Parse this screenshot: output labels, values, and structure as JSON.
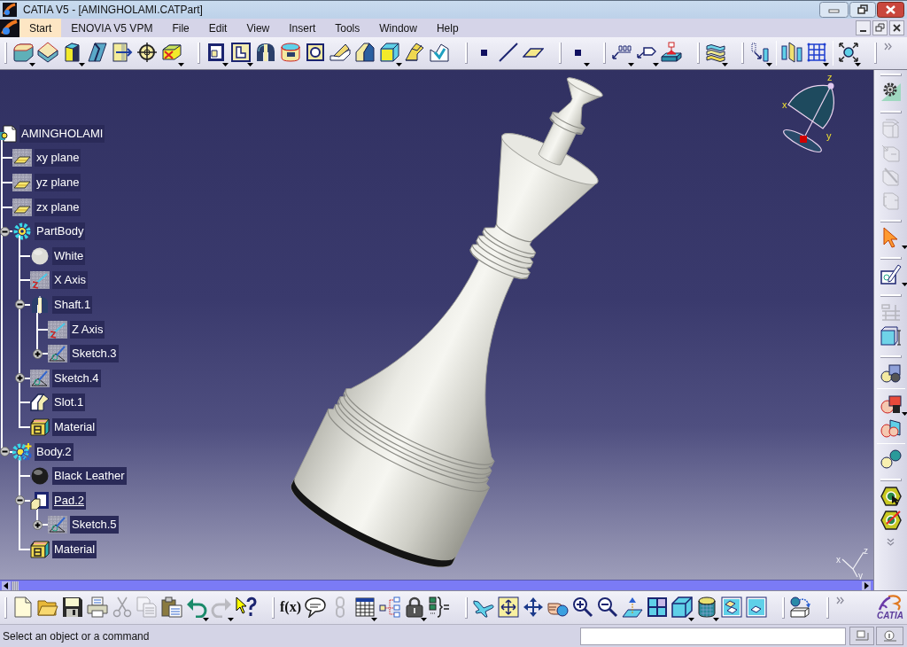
{
  "window": {
    "title": "CATIA V5 - [AMINGHOLAMI.CATPart]"
  },
  "menu": [
    {
      "label": "Start",
      "selected": true
    },
    {
      "label": "ENOVIA V5 VPM",
      "selected": false
    },
    {
      "label": "File",
      "selected": false
    },
    {
      "label": "Edit",
      "selected": false
    },
    {
      "label": "View",
      "selected": false
    },
    {
      "label": "Insert",
      "selected": false
    },
    {
      "label": "Tools",
      "selected": false
    },
    {
      "label": "Window",
      "selected": false
    },
    {
      "label": "Help",
      "selected": false
    }
  ],
  "top_toolbar": {
    "groups": [
      {
        "sections": [
          [
            {
              "kind": "pad",
              "menu": true
            },
            {
              "kind": "pocket",
              "menu": false
            },
            {
              "kind": "shaft",
              "menu": true
            },
            {
              "kind": "rib",
              "menu": false
            },
            {
              "kind": "hole",
              "menu": false
            },
            {
              "kind": "target",
              "menu": false
            },
            {
              "kind": "remove",
              "menu": true
            }
          ]
        ]
      },
      {
        "sections": [
          [
            {
              "kind": "frame",
              "menu": true
            },
            {
              "kind": "lframe",
              "menu": true
            },
            {
              "kind": "splitcyl",
              "menu": false
            },
            {
              "kind": "cylinder",
              "menu": false
            },
            {
              "kind": "ring",
              "menu": false
            },
            {
              "kind": "wedge",
              "menu": false
            },
            {
              "kind": "step",
              "menu": false
            },
            {
              "kind": "cube",
              "menu": true
            },
            {
              "kind": "sheet",
              "menu": false
            },
            {
              "kind": "splitsheet",
              "menu": false
            }
          ]
        ]
      },
      {
        "sections": [
          [
            {
              "kind": "point",
              "menu": false
            },
            {
              "kind": "line",
              "menu": false
            },
            {
              "kind": "plane",
              "menu": false
            }
          ]
        ]
      },
      {
        "sections": [
          [
            {
              "kind": "point",
              "menu": true
            }
          ]
        ]
      },
      {
        "sections": [
          [
            {
              "kind": "textarrow",
              "menu": true
            },
            {
              "kind": "tagarrow",
              "menu": true
            },
            {
              "kind": "stamp",
              "menu": false
            }
          ]
        ]
      },
      {
        "sections": [
          [
            {
              "kind": "layers",
              "menu": true
            }
          ]
        ]
      },
      {
        "sections": [
          [
            {
              "kind": "colarrow",
              "menu": true
            }
          ],
          [
            {
              "kind": "mirror",
              "menu": false
            },
            {
              "kind": "grid",
              "menu": true
            }
          ],
          [
            {
              "kind": "fit",
              "menu": true
            }
          ]
        ]
      }
    ],
    "overflow": true
  },
  "tree": {
    "label": "AMINGHOLAMI",
    "kind": "part",
    "in_work": false,
    "children": [
      {
        "label": "xy plane",
        "kind": "plane",
        "in_work": false
      },
      {
        "label": "yz plane",
        "kind": "plane",
        "in_work": false
      },
      {
        "label": "zx plane",
        "kind": "plane",
        "in_work": false
      },
      {
        "label": "PartBody",
        "kind": "body",
        "in_work": false,
        "expanded": true,
        "children": [
          {
            "label": "White",
            "kind": "appearance",
            "color": "#dcdcd6",
            "in_work": false
          },
          {
            "label": "X Axis",
            "kind": "axis",
            "in_work": false
          },
          {
            "label": "Shaft.1",
            "kind": "shaft",
            "in_work": false,
            "expanded": true,
            "children": [
              {
                "label": "Z Axis",
                "kind": "axis",
                "in_work": false
              },
              {
                "label": "Sketch.3",
                "kind": "sketch",
                "in_work": false,
                "expanded": false
              }
            ]
          },
          {
            "label": "Sketch.4",
            "kind": "sketch",
            "in_work": false,
            "expanded": false
          },
          {
            "label": "Slot.1",
            "kind": "slot",
            "in_work": false
          },
          {
            "label": "Material",
            "kind": "material",
            "in_work": false
          }
        ]
      },
      {
        "label": "Body.2",
        "kind": "newbody",
        "in_work": false,
        "expanded": true,
        "children": [
          {
            "label": "Black Leather",
            "kind": "appearance",
            "color": "#1c1c1c",
            "in_work": false
          },
          {
            "label": "Pad.2",
            "kind": "pad",
            "in_work": true,
            "expanded": true,
            "children": [
              {
                "label": "Sketch.5",
                "kind": "sketch",
                "in_work": false,
                "expanded": false
              }
            ]
          },
          {
            "label": "Material",
            "kind": "material",
            "in_work": false
          }
        ]
      }
    ]
  },
  "compass": {
    "labels": [
      "z",
      "x",
      "y"
    ]
  },
  "axis_triad": {
    "labels": [
      "z",
      "x",
      "y"
    ]
  },
  "right_toolbar": {
    "groups": [
      {
        "sections": [
          [
            {
              "kind": "gear",
              "menu": false,
              "disabled": false
            }
          ]
        ]
      },
      {
        "sections": [
          [
            {
              "kind": "stackblock",
              "menu": false,
              "disabled": true
            },
            {
              "kind": "arrowblock",
              "menu": false,
              "disabled": true
            },
            {
              "kind": "cutblock",
              "menu": false,
              "disabled": true
            },
            {
              "kind": "bracketblock",
              "menu": false,
              "disabled": true
            }
          ]
        ]
      },
      {
        "sections": [
          [
            {
              "kind": "cursor",
              "menu": true,
              "disabled": false
            }
          ]
        ]
      },
      {
        "sections": [
          [
            {
              "kind": "pencilsheet",
              "menu": true,
              "disabled": false
            }
          ]
        ]
      },
      {
        "sections": [
          [
            {
              "kind": "shelf",
              "menu": false,
              "disabled": true
            },
            {
              "kind": "dimension",
              "menu": false,
              "disabled": false
            }
          ]
        ]
      },
      {
        "sections": [
          [
            {
              "kind": "assembly",
              "menu": false,
              "disabled": false
            }
          ],
          [
            {
              "kind": "partstack",
              "menu": true,
              "disabled": false
            },
            {
              "kind": "partpair",
              "menu": false,
              "disabled": false
            }
          ],
          [
            {
              "kind": "spheres",
              "menu": false,
              "disabled": false
            }
          ]
        ]
      },
      {
        "sections": [
          [
            {
              "kind": "hexcursor",
              "menu": false,
              "disabled": false
            },
            {
              "kind": "hexslash",
              "menu": false,
              "disabled": false
            }
          ]
        ]
      }
    ],
    "overflow": true
  },
  "bottom_toolbar": {
    "groups": [
      {
        "sections": [
          [
            {
              "kind": "new",
              "menu": false,
              "disabled": false
            },
            {
              "kind": "open",
              "menu": false,
              "disabled": false
            },
            {
              "kind": "save",
              "menu": false,
              "disabled": false
            },
            {
              "kind": "print",
              "menu": false,
              "disabled": false
            },
            {
              "kind": "cut",
              "menu": false,
              "disabled": true
            },
            {
              "kind": "copy",
              "menu": false,
              "disabled": true
            },
            {
              "kind": "paste",
              "menu": false,
              "disabled": false
            },
            {
              "kind": "undo",
              "menu": true,
              "disabled": false
            },
            {
              "kind": "redo",
              "menu": true,
              "disabled": true
            },
            {
              "kind": "whatsthis",
              "menu": false,
              "disabled": false
            }
          ]
        ]
      },
      {
        "sections": [
          [
            {
              "kind": "formula",
              "label": "f(x)",
              "menu": false,
              "disabled": false
            },
            {
              "kind": "comment",
              "menu": false,
              "disabled": false
            },
            {
              "kind": "link",
              "menu": false,
              "disabled": true
            },
            {
              "kind": "table",
              "menu": true,
              "disabled": false
            },
            {
              "kind": "treeview",
              "menu": false,
              "disabled": false
            },
            {
              "kind": "lock",
              "menu": true,
              "disabled": false
            },
            {
              "kind": "equation",
              "menu": false,
              "disabled": false
            }
          ]
        ]
      },
      {
        "sections": [
          [
            {
              "kind": "fly",
              "menu": false,
              "disabled": false
            },
            {
              "kind": "fitall",
              "menu": false,
              "disabled": false
            },
            {
              "kind": "pan",
              "menu": false,
              "disabled": false
            },
            {
              "kind": "rotate",
              "menu": false,
              "disabled": false
            },
            {
              "kind": "zoomin",
              "menu": false,
              "disabled": false
            },
            {
              "kind": "zoomout",
              "menu": false,
              "disabled": false
            },
            {
              "kind": "normal",
              "menu": false,
              "disabled": false
            },
            {
              "kind": "multiview",
              "menu": false,
              "disabled": false
            },
            {
              "kind": "iso",
              "menu": true,
              "disabled": false
            },
            {
              "kind": "shading",
              "menu": true,
              "disabled": false
            },
            {
              "kind": "hide",
              "menu": false,
              "disabled": false
            },
            {
              "kind": "swap",
              "menu": false,
              "disabled": false
            }
          ]
        ]
      },
      {
        "sections": [
          [
            {
              "kind": "switch",
              "menu": false,
              "disabled": false
            }
          ]
        ]
      }
    ],
    "overflow": true
  },
  "logo": {
    "text": "CATIA"
  },
  "status_bar": {
    "message": "Select an object or a command"
  }
}
